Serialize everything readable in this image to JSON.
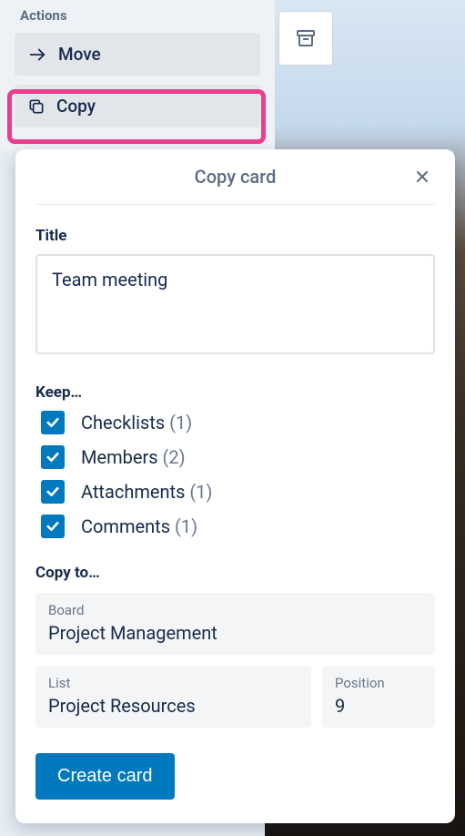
{
  "actions": {
    "header": "Actions",
    "items": [
      {
        "label": "Move"
      },
      {
        "label": "Copy"
      }
    ]
  },
  "modal": {
    "title": "Copy card",
    "title_field": {
      "label": "Title",
      "value": "Team meeting"
    },
    "keep": {
      "label": "Keep…",
      "items": [
        {
          "label": "Checklists",
          "count": "(1)",
          "checked": true
        },
        {
          "label": "Members",
          "count": "(2)",
          "checked": true
        },
        {
          "label": "Attachments",
          "count": "(1)",
          "checked": true
        },
        {
          "label": "Comments",
          "count": "(1)",
          "checked": true
        }
      ]
    },
    "copy_to": {
      "label": "Copy to…",
      "board": {
        "label": "Board",
        "value": "Project Management"
      },
      "list": {
        "label": "List",
        "value": "Project Resources"
      },
      "position": {
        "label": "Position",
        "value": "9"
      }
    },
    "submit": "Create card"
  }
}
